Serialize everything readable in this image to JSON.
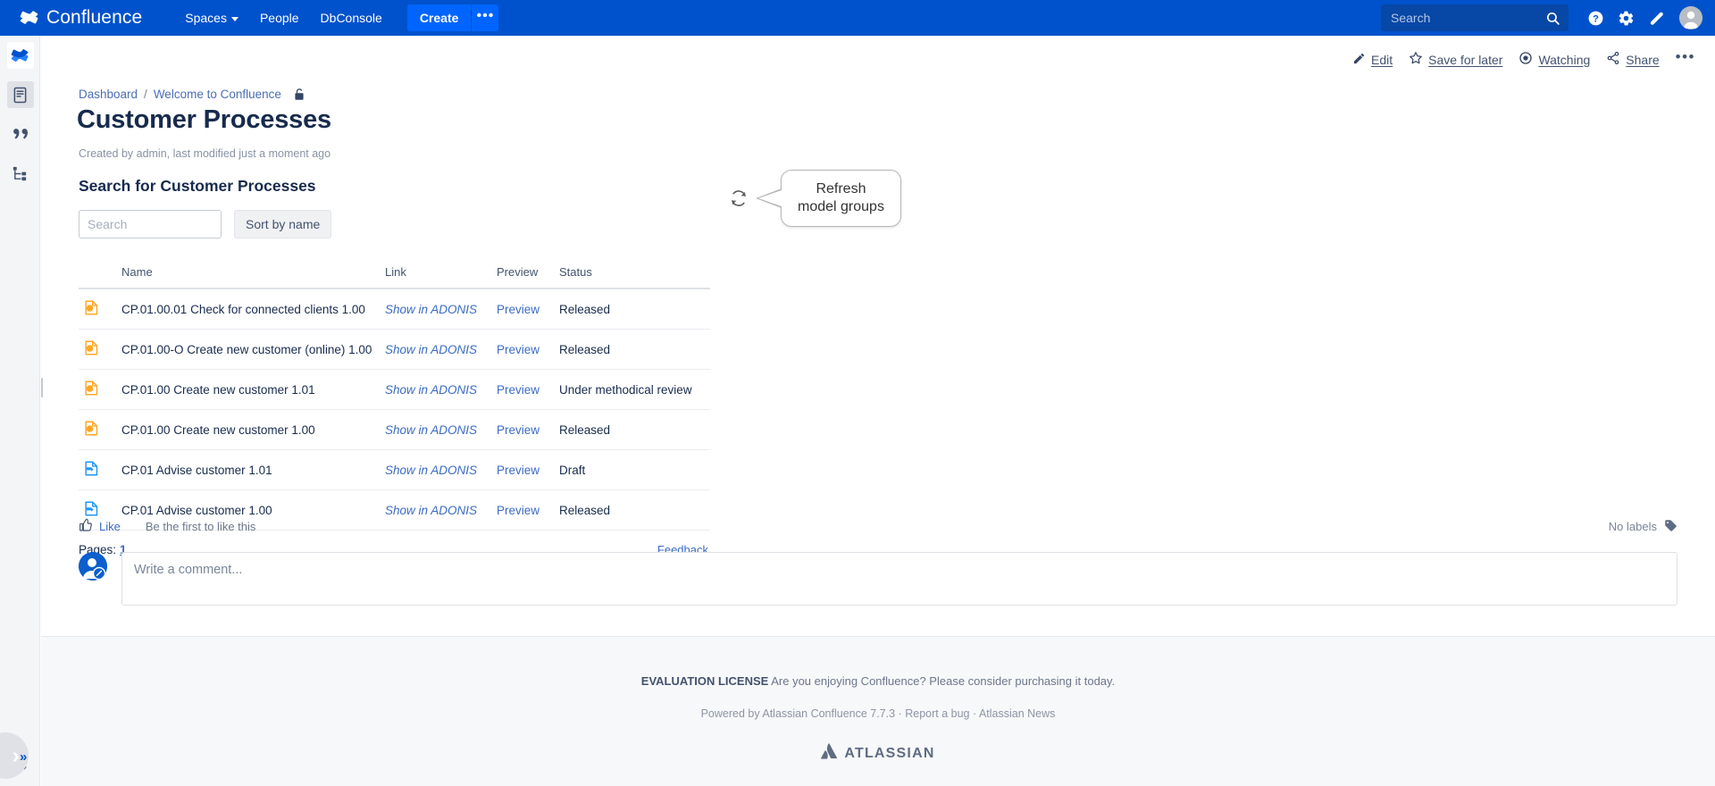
{
  "topnav": {
    "brand": "Confluence",
    "brand_icon": "confluence-logo-icon",
    "items": [
      {
        "label": "Spaces",
        "has_caret": true
      },
      {
        "label": "People",
        "has_caret": false
      },
      {
        "label": "DbConsole",
        "has_caret": false
      }
    ],
    "create_label": "Create",
    "create_more_label": "•••",
    "search_placeholder": "Search",
    "search_value": "",
    "icons": [
      "help-icon",
      "settings-gear-icon",
      "notifications-bell-icon",
      "user-avatar-icon"
    ]
  },
  "leftrail": {
    "items": [
      {
        "name": "confluence-home-icon",
        "selected": false
      },
      {
        "name": "pages-icon",
        "selected": true
      },
      {
        "name": "blog-quote-icon",
        "selected": false
      },
      {
        "name": "page-tree-icon",
        "selected": false
      }
    ],
    "settings_icon": "space-settings-gear-icon",
    "expand_label": "»"
  },
  "page_actions": [
    {
      "label": "Edit",
      "icon": "pencil-icon"
    },
    {
      "label": "Save for later",
      "icon": "star-icon"
    },
    {
      "label": "Watching",
      "icon": "eye-icon"
    },
    {
      "label": "Share",
      "icon": "share-icon"
    }
  ],
  "page_actions_more": "•••",
  "breadcrumb": {
    "items": [
      "Dashboard",
      "Welcome to Confluence"
    ],
    "separator": "/",
    "restriction_icon": "padlock-icon"
  },
  "page": {
    "title": "Customer Processes",
    "meta": "Created by admin, last modified just a moment ago"
  },
  "macro": {
    "title": "Search for Customer Processes",
    "search_placeholder": "Search",
    "search_value": "",
    "sort_button": "Sort by name",
    "refresh_icon": "refresh-circular-arrows-icon",
    "tooltip": "Refresh\nmodel groups",
    "columns": [
      "",
      "Name",
      "Link",
      "Preview",
      "Status"
    ],
    "rows": [
      {
        "icon": "orange-document-icon",
        "name": "CP.01.00.01 Check for connected clients 1.00",
        "link": "Show in ADONIS",
        "preview": "Preview",
        "status": "Released"
      },
      {
        "icon": "orange-document-icon",
        "name": "CP.01.00-O Create new customer (online) 1.00",
        "link": "Show in ADONIS",
        "preview": "Preview",
        "status": "Released"
      },
      {
        "icon": "orange-document-icon",
        "name": "CP.01.00 Create new customer 1.01",
        "link": "Show in ADONIS",
        "preview": "Preview",
        "status": "Under methodical review"
      },
      {
        "icon": "orange-document-icon",
        "name": "CP.01.00 Create new customer 1.00",
        "link": "Show in ADONIS",
        "preview": "Preview",
        "status": "Released"
      },
      {
        "icon": "blue-document-icon",
        "name": "CP.01 Advise customer 1.01",
        "link": "Show in ADONIS",
        "preview": "Preview",
        "status": "Draft"
      },
      {
        "icon": "blue-document-icon",
        "name": "CP.01 Advise customer 1.00",
        "link": "Show in ADONIS",
        "preview": "Preview",
        "status": "Released"
      }
    ],
    "pages_label": "Pages:",
    "pages_current": "1",
    "feedback_label": "Feedback"
  },
  "social": {
    "like_label": "Like",
    "like_icon": "thumbs-up-icon",
    "like_note": "Be the first to like this",
    "labels_text": "No labels",
    "labels_icon": "label-tag-icon"
  },
  "comment": {
    "placeholder": "Write a comment...",
    "avatar_icon": "user-edit-avatar-icon"
  },
  "footer": {
    "eval_bold": "EVALUATION LICENSE",
    "eval_text": "Are you enjoying Confluence? Please consider purchasing it today.",
    "powered_by": "Powered by Atlassian Confluence 7.7.3",
    "dot1": "·",
    "report_bug": "Report a bug",
    "dot2": "·",
    "atlassian_news": "Atlassian News",
    "logo_text": "ATLASSIAN",
    "logo_icon": "atlassian-logo-icon"
  },
  "colors": {
    "nav_blue": "#0052CC",
    "create_blue": "#0065FF",
    "link_blue": "#3B6BC4",
    "orange_doc": "#FFA726",
    "blue_doc": "#2196F3",
    "text_dark": "#172B4D"
  }
}
